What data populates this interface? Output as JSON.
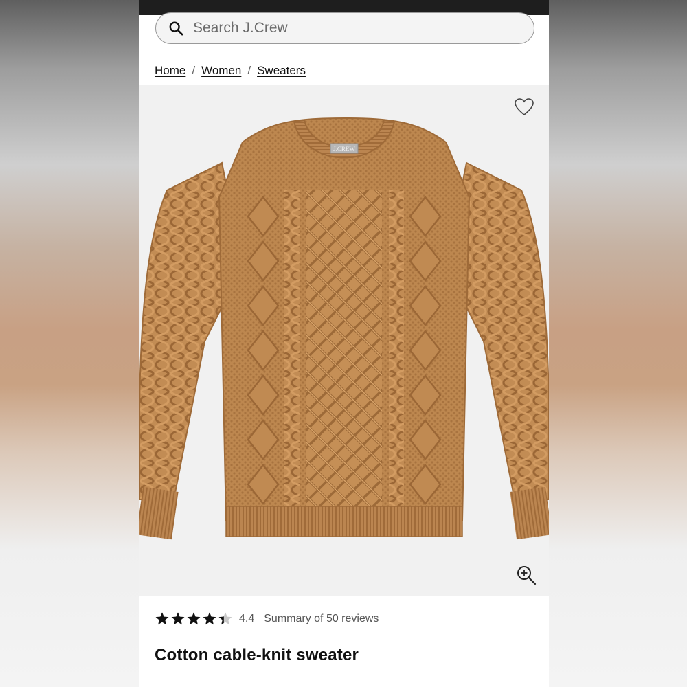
{
  "search": {
    "placeholder": "Search J.Crew",
    "icon": "search-icon"
  },
  "breadcrumb": [
    {
      "label": "Home"
    },
    {
      "label": "Women"
    },
    {
      "label": "Sweaters"
    }
  ],
  "breadcrumb_separator": "/",
  "product": {
    "image_label_text": "J.CREW",
    "rating": {
      "value": "4.4",
      "stars": 4.4,
      "max_stars": 5
    },
    "reviews_link": "Summary of 50 reviews",
    "title": "Cotton cable-knit sweater",
    "color_hex": "#c08a52"
  },
  "icons": {
    "favorite": "heart-icon",
    "zoom": "zoom-in-icon"
  }
}
